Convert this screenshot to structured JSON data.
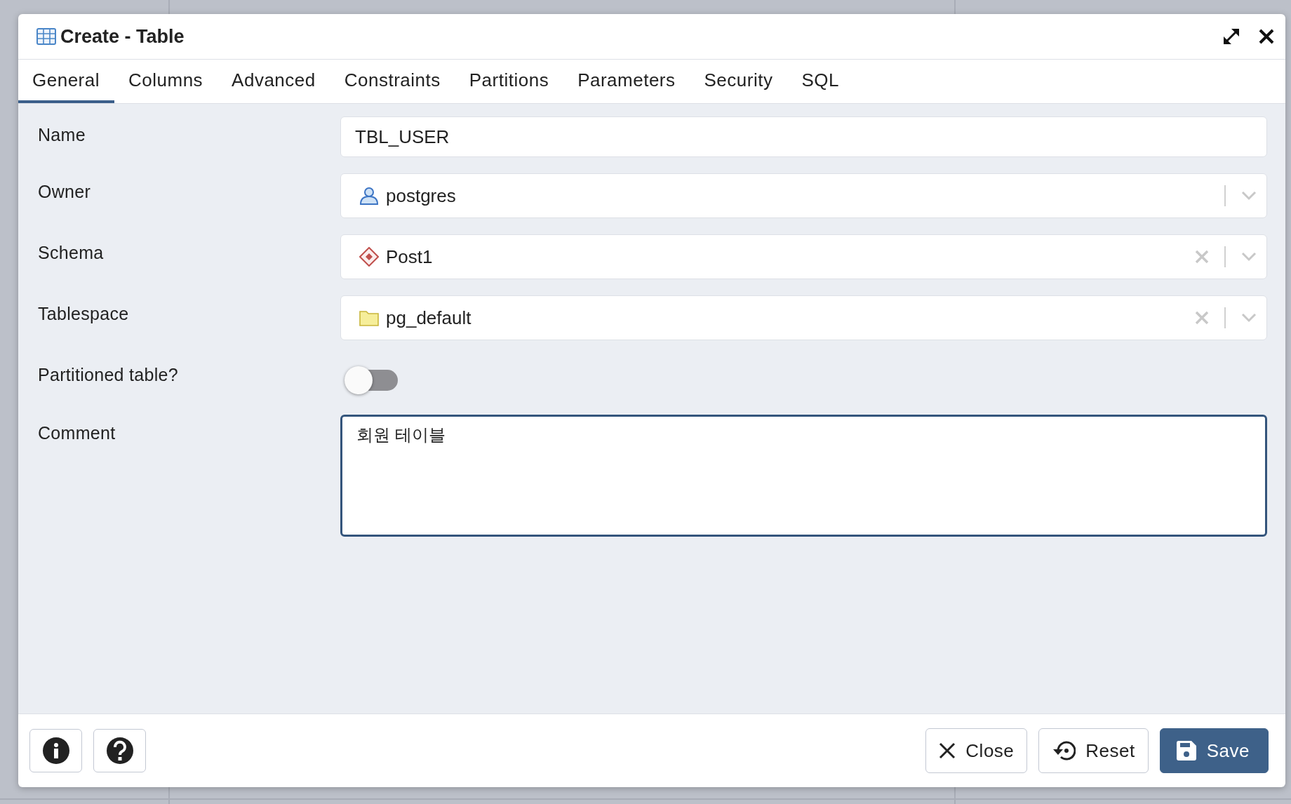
{
  "dialog": {
    "title": "Create - Table"
  },
  "tabs": [
    {
      "label": "General",
      "selected": true
    },
    {
      "label": "Columns",
      "selected": false
    },
    {
      "label": "Advanced",
      "selected": false
    },
    {
      "label": "Constraints",
      "selected": false
    },
    {
      "label": "Partitions",
      "selected": false
    },
    {
      "label": "Parameters",
      "selected": false
    },
    {
      "label": "Security",
      "selected": false
    },
    {
      "label": "SQL",
      "selected": false
    }
  ],
  "name": {
    "label": "Name",
    "value": "TBL_USER"
  },
  "owner": {
    "label": "Owner",
    "value": "postgres",
    "clearable": false
  },
  "schema": {
    "label": "Schema",
    "value": "Post1",
    "clearable": true
  },
  "tablespace": {
    "label": "Tablespace",
    "value": "pg_default",
    "clearable": true
  },
  "partitioned": {
    "label": "Partitioned table?",
    "on": false
  },
  "comment": {
    "label": "Comment",
    "value": "회원 테이블",
    "focused": true
  },
  "footer": {
    "buttons": [
      {
        "kind": "close",
        "label": "Close"
      },
      {
        "kind": "reset",
        "label": "Reset"
      },
      {
        "kind": "save",
        "label": "Save"
      }
    ]
  }
}
